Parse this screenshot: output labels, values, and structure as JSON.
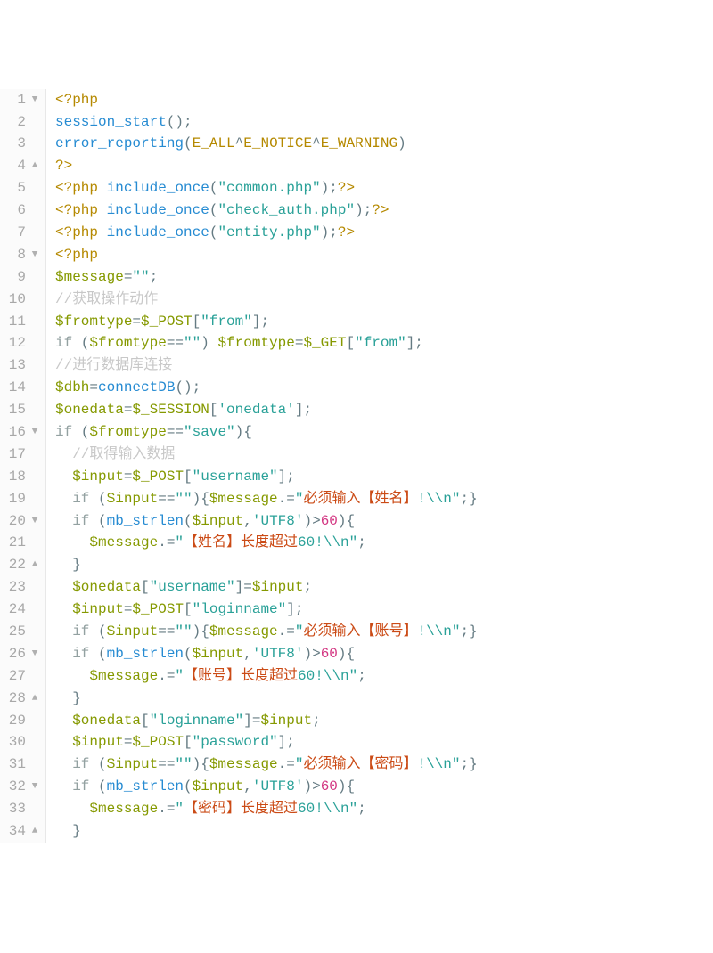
{
  "gutter": [
    {
      "n": "1",
      "fold": "▼"
    },
    {
      "n": "2",
      "fold": ""
    },
    {
      "n": "3",
      "fold": ""
    },
    {
      "n": "4",
      "fold": "▲"
    },
    {
      "n": "5",
      "fold": ""
    },
    {
      "n": "6",
      "fold": ""
    },
    {
      "n": "7",
      "fold": ""
    },
    {
      "n": "8",
      "fold": "▼"
    },
    {
      "n": "9",
      "fold": ""
    },
    {
      "n": "10",
      "fold": ""
    },
    {
      "n": "11",
      "fold": ""
    },
    {
      "n": "12",
      "fold": ""
    },
    {
      "n": "13",
      "fold": ""
    },
    {
      "n": "14",
      "fold": ""
    },
    {
      "n": "15",
      "fold": ""
    },
    {
      "n": "16",
      "fold": "▼"
    },
    {
      "n": "17",
      "fold": ""
    },
    {
      "n": "18",
      "fold": ""
    },
    {
      "n": "19",
      "fold": ""
    },
    {
      "n": "20",
      "fold": "▼"
    },
    {
      "n": "21",
      "fold": ""
    },
    {
      "n": "22",
      "fold": "▲"
    },
    {
      "n": "23",
      "fold": ""
    },
    {
      "n": "24",
      "fold": ""
    },
    {
      "n": "25",
      "fold": ""
    },
    {
      "n": "26",
      "fold": "▼"
    },
    {
      "n": "27",
      "fold": ""
    },
    {
      "n": "28",
      "fold": "▲"
    },
    {
      "n": "29",
      "fold": ""
    },
    {
      "n": "30",
      "fold": ""
    },
    {
      "n": "31",
      "fold": ""
    },
    {
      "n": "32",
      "fold": "▼"
    },
    {
      "n": "33",
      "fold": ""
    },
    {
      "n": "34",
      "fold": "▲"
    }
  ],
  "lines": [
    [
      {
        "c": "t-br",
        "t": "<?php"
      }
    ],
    [
      {
        "c": "t-fn",
        "t": "session_start"
      },
      {
        "c": "t-pn",
        "t": "();"
      }
    ],
    [
      {
        "c": "t-fn",
        "t": "error_reporting"
      },
      {
        "c": "t-pn",
        "t": "("
      },
      {
        "c": "t-id",
        "t": "E_ALL"
      },
      {
        "c": "t-op",
        "t": "^"
      },
      {
        "c": "t-id",
        "t": "E_NOTICE"
      },
      {
        "c": "t-op",
        "t": "^"
      },
      {
        "c": "t-id",
        "t": "E_WARNING"
      },
      {
        "c": "t-pn",
        "t": ")"
      }
    ],
    [
      {
        "c": "t-br",
        "t": "?>"
      }
    ],
    [
      {
        "c": "t-br",
        "t": "<?php "
      },
      {
        "c": "t-fn",
        "t": "include_once"
      },
      {
        "c": "t-pn",
        "t": "("
      },
      {
        "c": "t-str",
        "t": "\"common.php\""
      },
      {
        "c": "t-pn",
        "t": ");"
      },
      {
        "c": "t-br",
        "t": "?>"
      }
    ],
    [
      {
        "c": "t-br",
        "t": "<?php "
      },
      {
        "c": "t-fn",
        "t": "include_once"
      },
      {
        "c": "t-pn",
        "t": "("
      },
      {
        "c": "t-str",
        "t": "\"check_auth.php\""
      },
      {
        "c": "t-pn",
        "t": ");"
      },
      {
        "c": "t-br",
        "t": "?>"
      }
    ],
    [
      {
        "c": "t-br",
        "t": "<?php "
      },
      {
        "c": "t-fn",
        "t": "include_once"
      },
      {
        "c": "t-pn",
        "t": "("
      },
      {
        "c": "t-str",
        "t": "\"entity.php\""
      },
      {
        "c": "t-pn",
        "t": ");"
      },
      {
        "c": "t-br",
        "t": "?>"
      }
    ],
    [
      {
        "c": "t-br",
        "t": "<?php"
      }
    ],
    [
      {
        "c": "t-var",
        "t": "$message"
      },
      {
        "c": "t-op",
        "t": "="
      },
      {
        "c": "t-str",
        "t": "\"\""
      },
      {
        "c": "t-pn",
        "t": ";"
      }
    ],
    [
      {
        "c": "t-cmt",
        "t": "//获取操作动作"
      }
    ],
    [
      {
        "c": "t-var",
        "t": "$fromtype"
      },
      {
        "c": "t-op",
        "t": "="
      },
      {
        "c": "t-var",
        "t": "$_POST"
      },
      {
        "c": "t-pn",
        "t": "["
      },
      {
        "c": "t-str",
        "t": "\"from\""
      },
      {
        "c": "t-pn",
        "t": "];"
      }
    ],
    [
      {
        "c": "t-kw",
        "t": "if"
      },
      {
        "c": "t-pn",
        "t": " ("
      },
      {
        "c": "t-var",
        "t": "$fromtype"
      },
      {
        "c": "t-op",
        "t": "=="
      },
      {
        "c": "t-str",
        "t": "\"\""
      },
      {
        "c": "t-pn",
        "t": ") "
      },
      {
        "c": "t-var",
        "t": "$fromtype"
      },
      {
        "c": "t-op",
        "t": "="
      },
      {
        "c": "t-var",
        "t": "$_GET"
      },
      {
        "c": "t-pn",
        "t": "["
      },
      {
        "c": "t-str",
        "t": "\"from\""
      },
      {
        "c": "t-pn",
        "t": "];"
      }
    ],
    [
      {
        "c": "t-cmt",
        "t": "//进行数据库连接"
      }
    ],
    [
      {
        "c": "t-var",
        "t": "$dbh"
      },
      {
        "c": "t-op",
        "t": "="
      },
      {
        "c": "t-fn",
        "t": "connectDB"
      },
      {
        "c": "t-pn",
        "t": "();"
      }
    ],
    [
      {
        "c": "t-var",
        "t": "$onedata"
      },
      {
        "c": "t-op",
        "t": "="
      },
      {
        "c": "t-var",
        "t": "$_SESSION"
      },
      {
        "c": "t-pn",
        "t": "["
      },
      {
        "c": "t-str",
        "t": "'onedata'"
      },
      {
        "c": "t-pn",
        "t": "];"
      }
    ],
    [
      {
        "c": "t-kw",
        "t": "if"
      },
      {
        "c": "t-pn",
        "t": " ("
      },
      {
        "c": "t-var",
        "t": "$fromtype"
      },
      {
        "c": "t-op",
        "t": "=="
      },
      {
        "c": "t-str",
        "t": "\"save\""
      },
      {
        "c": "t-pn",
        "t": "){"
      }
    ],
    [
      {
        "c": "",
        "t": "  "
      },
      {
        "c": "t-cmt",
        "t": "//取得输入数据"
      }
    ],
    [
      {
        "c": "",
        "t": "  "
      },
      {
        "c": "t-var",
        "t": "$input"
      },
      {
        "c": "t-op",
        "t": "="
      },
      {
        "c": "t-var",
        "t": "$_POST"
      },
      {
        "c": "t-pn",
        "t": "["
      },
      {
        "c": "t-str",
        "t": "\"username\""
      },
      {
        "c": "t-pn",
        "t": "];"
      }
    ],
    [
      {
        "c": "",
        "t": "  "
      },
      {
        "c": "t-kw",
        "t": "if"
      },
      {
        "c": "t-pn",
        "t": " ("
      },
      {
        "c": "t-var",
        "t": "$input"
      },
      {
        "c": "t-op",
        "t": "=="
      },
      {
        "c": "t-str",
        "t": "\"\""
      },
      {
        "c": "t-pn",
        "t": "){"
      },
      {
        "c": "t-var",
        "t": "$message"
      },
      {
        "c": "t-op",
        "t": ".="
      },
      {
        "c": "t-str",
        "t": "\""
      },
      {
        "c": "t-cjk",
        "t": "必须输入【姓名】"
      },
      {
        "c": "t-str",
        "t": "!\\\\n\""
      },
      {
        "c": "t-pn",
        "t": ";}"
      }
    ],
    [
      {
        "c": "",
        "t": "  "
      },
      {
        "c": "t-kw",
        "t": "if"
      },
      {
        "c": "t-pn",
        "t": " ("
      },
      {
        "c": "t-fn",
        "t": "mb_strlen"
      },
      {
        "c": "t-pn",
        "t": "("
      },
      {
        "c": "t-var",
        "t": "$input"
      },
      {
        "c": "t-pn",
        "t": ","
      },
      {
        "c": "t-str",
        "t": "'UTF8'"
      },
      {
        "c": "t-pn",
        "t": ")"
      },
      {
        "c": "t-op",
        "t": ">"
      },
      {
        "c": "t-num",
        "t": "60"
      },
      {
        "c": "t-pn",
        "t": "){"
      }
    ],
    [
      {
        "c": "",
        "t": "    "
      },
      {
        "c": "t-var",
        "t": "$message"
      },
      {
        "c": "t-op",
        "t": ".="
      },
      {
        "c": "t-str",
        "t": "\""
      },
      {
        "c": "t-cjk",
        "t": "【姓名】长度超过"
      },
      {
        "c": "t-str",
        "t": "60!\\\\n\""
      },
      {
        "c": "t-pn",
        "t": ";"
      }
    ],
    [
      {
        "c": "",
        "t": "  "
      },
      {
        "c": "t-pn",
        "t": "}"
      }
    ],
    [
      {
        "c": "",
        "t": "  "
      },
      {
        "c": "t-var",
        "t": "$onedata"
      },
      {
        "c": "t-pn",
        "t": "["
      },
      {
        "c": "t-str",
        "t": "\"username\""
      },
      {
        "c": "t-pn",
        "t": "]"
      },
      {
        "c": "t-op",
        "t": "="
      },
      {
        "c": "t-var",
        "t": "$input"
      },
      {
        "c": "t-pn",
        "t": ";"
      }
    ],
    [
      {
        "c": "",
        "t": "  "
      },
      {
        "c": "t-var",
        "t": "$input"
      },
      {
        "c": "t-op",
        "t": "="
      },
      {
        "c": "t-var",
        "t": "$_POST"
      },
      {
        "c": "t-pn",
        "t": "["
      },
      {
        "c": "t-str",
        "t": "\"loginname\""
      },
      {
        "c": "t-pn",
        "t": "];"
      }
    ],
    [
      {
        "c": "",
        "t": "  "
      },
      {
        "c": "t-kw",
        "t": "if"
      },
      {
        "c": "t-pn",
        "t": " ("
      },
      {
        "c": "t-var",
        "t": "$input"
      },
      {
        "c": "t-op",
        "t": "=="
      },
      {
        "c": "t-str",
        "t": "\"\""
      },
      {
        "c": "t-pn",
        "t": "){"
      },
      {
        "c": "t-var",
        "t": "$message"
      },
      {
        "c": "t-op",
        "t": ".="
      },
      {
        "c": "t-str",
        "t": "\""
      },
      {
        "c": "t-cjk",
        "t": "必须输入【账号】"
      },
      {
        "c": "t-str",
        "t": "!\\\\n\""
      },
      {
        "c": "t-pn",
        "t": ";}"
      }
    ],
    [
      {
        "c": "",
        "t": "  "
      },
      {
        "c": "t-kw",
        "t": "if"
      },
      {
        "c": "t-pn",
        "t": " ("
      },
      {
        "c": "t-fn",
        "t": "mb_strlen"
      },
      {
        "c": "t-pn",
        "t": "("
      },
      {
        "c": "t-var",
        "t": "$input"
      },
      {
        "c": "t-pn",
        "t": ","
      },
      {
        "c": "t-str",
        "t": "'UTF8'"
      },
      {
        "c": "t-pn",
        "t": ")"
      },
      {
        "c": "t-op",
        "t": ">"
      },
      {
        "c": "t-num",
        "t": "60"
      },
      {
        "c": "t-pn",
        "t": "){"
      }
    ],
    [
      {
        "c": "",
        "t": "    "
      },
      {
        "c": "t-var",
        "t": "$message"
      },
      {
        "c": "t-op",
        "t": ".="
      },
      {
        "c": "t-str",
        "t": "\""
      },
      {
        "c": "t-cjk",
        "t": "【账号】长度超过"
      },
      {
        "c": "t-str",
        "t": "60!\\\\n\""
      },
      {
        "c": "t-pn",
        "t": ";"
      }
    ],
    [
      {
        "c": "",
        "t": "  "
      },
      {
        "c": "t-pn",
        "t": "}"
      }
    ],
    [
      {
        "c": "",
        "t": "  "
      },
      {
        "c": "t-var",
        "t": "$onedata"
      },
      {
        "c": "t-pn",
        "t": "["
      },
      {
        "c": "t-str",
        "t": "\"loginname\""
      },
      {
        "c": "t-pn",
        "t": "]"
      },
      {
        "c": "t-op",
        "t": "="
      },
      {
        "c": "t-var",
        "t": "$input"
      },
      {
        "c": "t-pn",
        "t": ";"
      }
    ],
    [
      {
        "c": "",
        "t": "  "
      },
      {
        "c": "t-var",
        "t": "$input"
      },
      {
        "c": "t-op",
        "t": "="
      },
      {
        "c": "t-var",
        "t": "$_POST"
      },
      {
        "c": "t-pn",
        "t": "["
      },
      {
        "c": "t-str",
        "t": "\"password\""
      },
      {
        "c": "t-pn",
        "t": "];"
      }
    ],
    [
      {
        "c": "",
        "t": "  "
      },
      {
        "c": "t-kw",
        "t": "if"
      },
      {
        "c": "t-pn",
        "t": " ("
      },
      {
        "c": "t-var",
        "t": "$input"
      },
      {
        "c": "t-op",
        "t": "=="
      },
      {
        "c": "t-str",
        "t": "\"\""
      },
      {
        "c": "t-pn",
        "t": "){"
      },
      {
        "c": "t-var",
        "t": "$message"
      },
      {
        "c": "t-op",
        "t": ".="
      },
      {
        "c": "t-str",
        "t": "\""
      },
      {
        "c": "t-cjk",
        "t": "必须输入【密码】"
      },
      {
        "c": "t-str",
        "t": "!\\\\n\""
      },
      {
        "c": "t-pn",
        "t": ";}"
      }
    ],
    [
      {
        "c": "",
        "t": "  "
      },
      {
        "c": "t-kw",
        "t": "if"
      },
      {
        "c": "t-pn",
        "t": " ("
      },
      {
        "c": "t-fn",
        "t": "mb_strlen"
      },
      {
        "c": "t-pn",
        "t": "("
      },
      {
        "c": "t-var",
        "t": "$input"
      },
      {
        "c": "t-pn",
        "t": ","
      },
      {
        "c": "t-str",
        "t": "'UTF8'"
      },
      {
        "c": "t-pn",
        "t": ")"
      },
      {
        "c": "t-op",
        "t": ">"
      },
      {
        "c": "t-num",
        "t": "60"
      },
      {
        "c": "t-pn",
        "t": "){"
      }
    ],
    [
      {
        "c": "",
        "t": "    "
      },
      {
        "c": "t-var",
        "t": "$message"
      },
      {
        "c": "t-op",
        "t": ".="
      },
      {
        "c": "t-str",
        "t": "\""
      },
      {
        "c": "t-cjk",
        "t": "【密码】长度超过"
      },
      {
        "c": "t-str",
        "t": "60!\\\\n\""
      },
      {
        "c": "t-pn",
        "t": ";"
      }
    ],
    [
      {
        "c": "",
        "t": "  "
      },
      {
        "c": "t-pn",
        "t": "}"
      }
    ]
  ]
}
